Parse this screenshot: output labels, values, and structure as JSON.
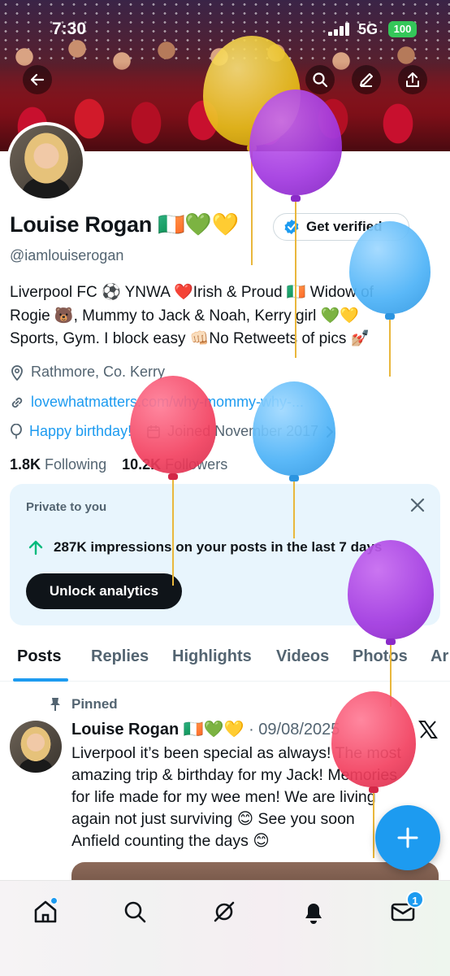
{
  "status_bar": {
    "time": "7:30",
    "network": "5G",
    "battery": "100"
  },
  "profile": {
    "name": "Louise Rogan",
    "name_emojis": "🇮🇪💚💛",
    "get_verified_label": "Get verified",
    "handle": "@iamlouiserogan",
    "bio_lines": [
      "Liverpool FC ⚽ YNWA ❤️Irish & Proud 🇮🇪 Widow of",
      "Rogie 🐻, Mummy to Jack & Noah, Kerry girl 💚💛",
      "Sports, Gym. I block easy 👊🏻No Retweets of pics 💅🏼"
    ],
    "location": "Rathmore, Co. Kerry",
    "link": "lovewhatmatters.com/why-mommy-why-...",
    "birthday": "Happy birthday!",
    "joined": "Joined November 2017",
    "following_count": "1.8K",
    "following_label": "Following",
    "followers_count": "10.2K",
    "followers_label": "Followers"
  },
  "analytics_card": {
    "private_label": "Private to you",
    "impressions_text": "287K impressions on your posts in the last 7 days",
    "unlock_label": "Unlock analytics"
  },
  "tabs": [
    "Posts",
    "Replies",
    "Highlights",
    "Videos",
    "Photos",
    "Ar"
  ],
  "post": {
    "pinned_label": "Pinned",
    "author": "Louise Rogan",
    "author_emojis": "🇮🇪💚💛",
    "date": "· 09/08/2025",
    "text_lines": [
      "Liverpool it’s been special as always! The most",
      "amazing trip & birthday for my Jack!  Memories",
      "for life made for my wee men! We are living",
      "again not just surviving 😊 See you soon",
      "Anfield counting the days 😊"
    ]
  },
  "nav": {
    "notifications_badge": "1"
  },
  "colors": {
    "accent": "#1d9bf0",
    "text": "#0f1419",
    "muted": "#536471",
    "card_bg": "#e8f5fd"
  },
  "icons": [
    "back-arrow-icon",
    "search-icon",
    "edit-icon",
    "share-icon",
    "verified-badge-icon",
    "location-icon",
    "link-icon",
    "balloon-icon",
    "calendar-icon",
    "chevron-right-icon",
    "close-icon",
    "arrow-up-icon",
    "pin-icon",
    "x-logo-icon",
    "plus-icon",
    "home-icon",
    "grok-icon",
    "bell-icon",
    "mail-icon"
  ]
}
